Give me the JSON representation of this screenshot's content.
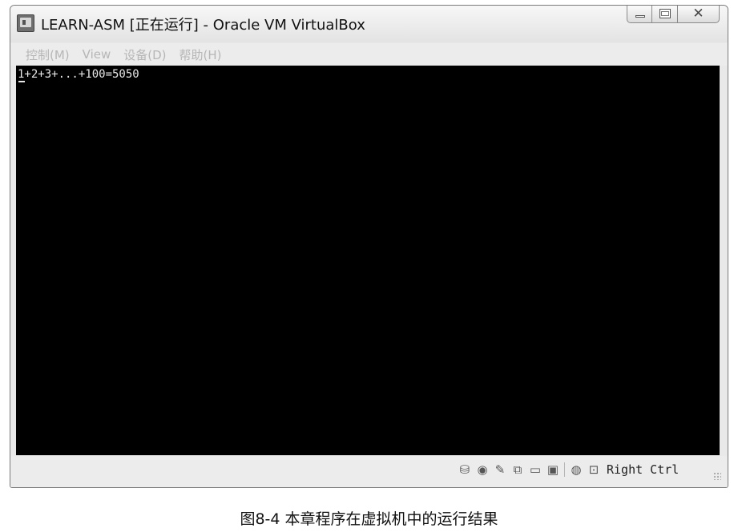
{
  "window": {
    "title": "LEARN-ASM [正在运行] - Oracle VM VirtualBox",
    "buttons": {
      "minimize": "—",
      "maximize": "□",
      "close": "✕"
    }
  },
  "menubar": {
    "items": [
      {
        "label": "控制(M)"
      },
      {
        "label": "View"
      },
      {
        "label": "设备(D)"
      },
      {
        "label": "帮助(H)"
      }
    ]
  },
  "screen": {
    "output": "1+2+3+...+100=5050"
  },
  "statusbar": {
    "icons": [
      "hard-disk-icon",
      "optical-drive-icon",
      "usb-icon",
      "shared-folders-icon",
      "display-icon",
      "recording-icon",
      "network-icon",
      "mouse-capture-icon"
    ],
    "host_key": "Right Ctrl"
  },
  "caption": "图8-4  本章程序在虚拟机中的运行结果"
}
